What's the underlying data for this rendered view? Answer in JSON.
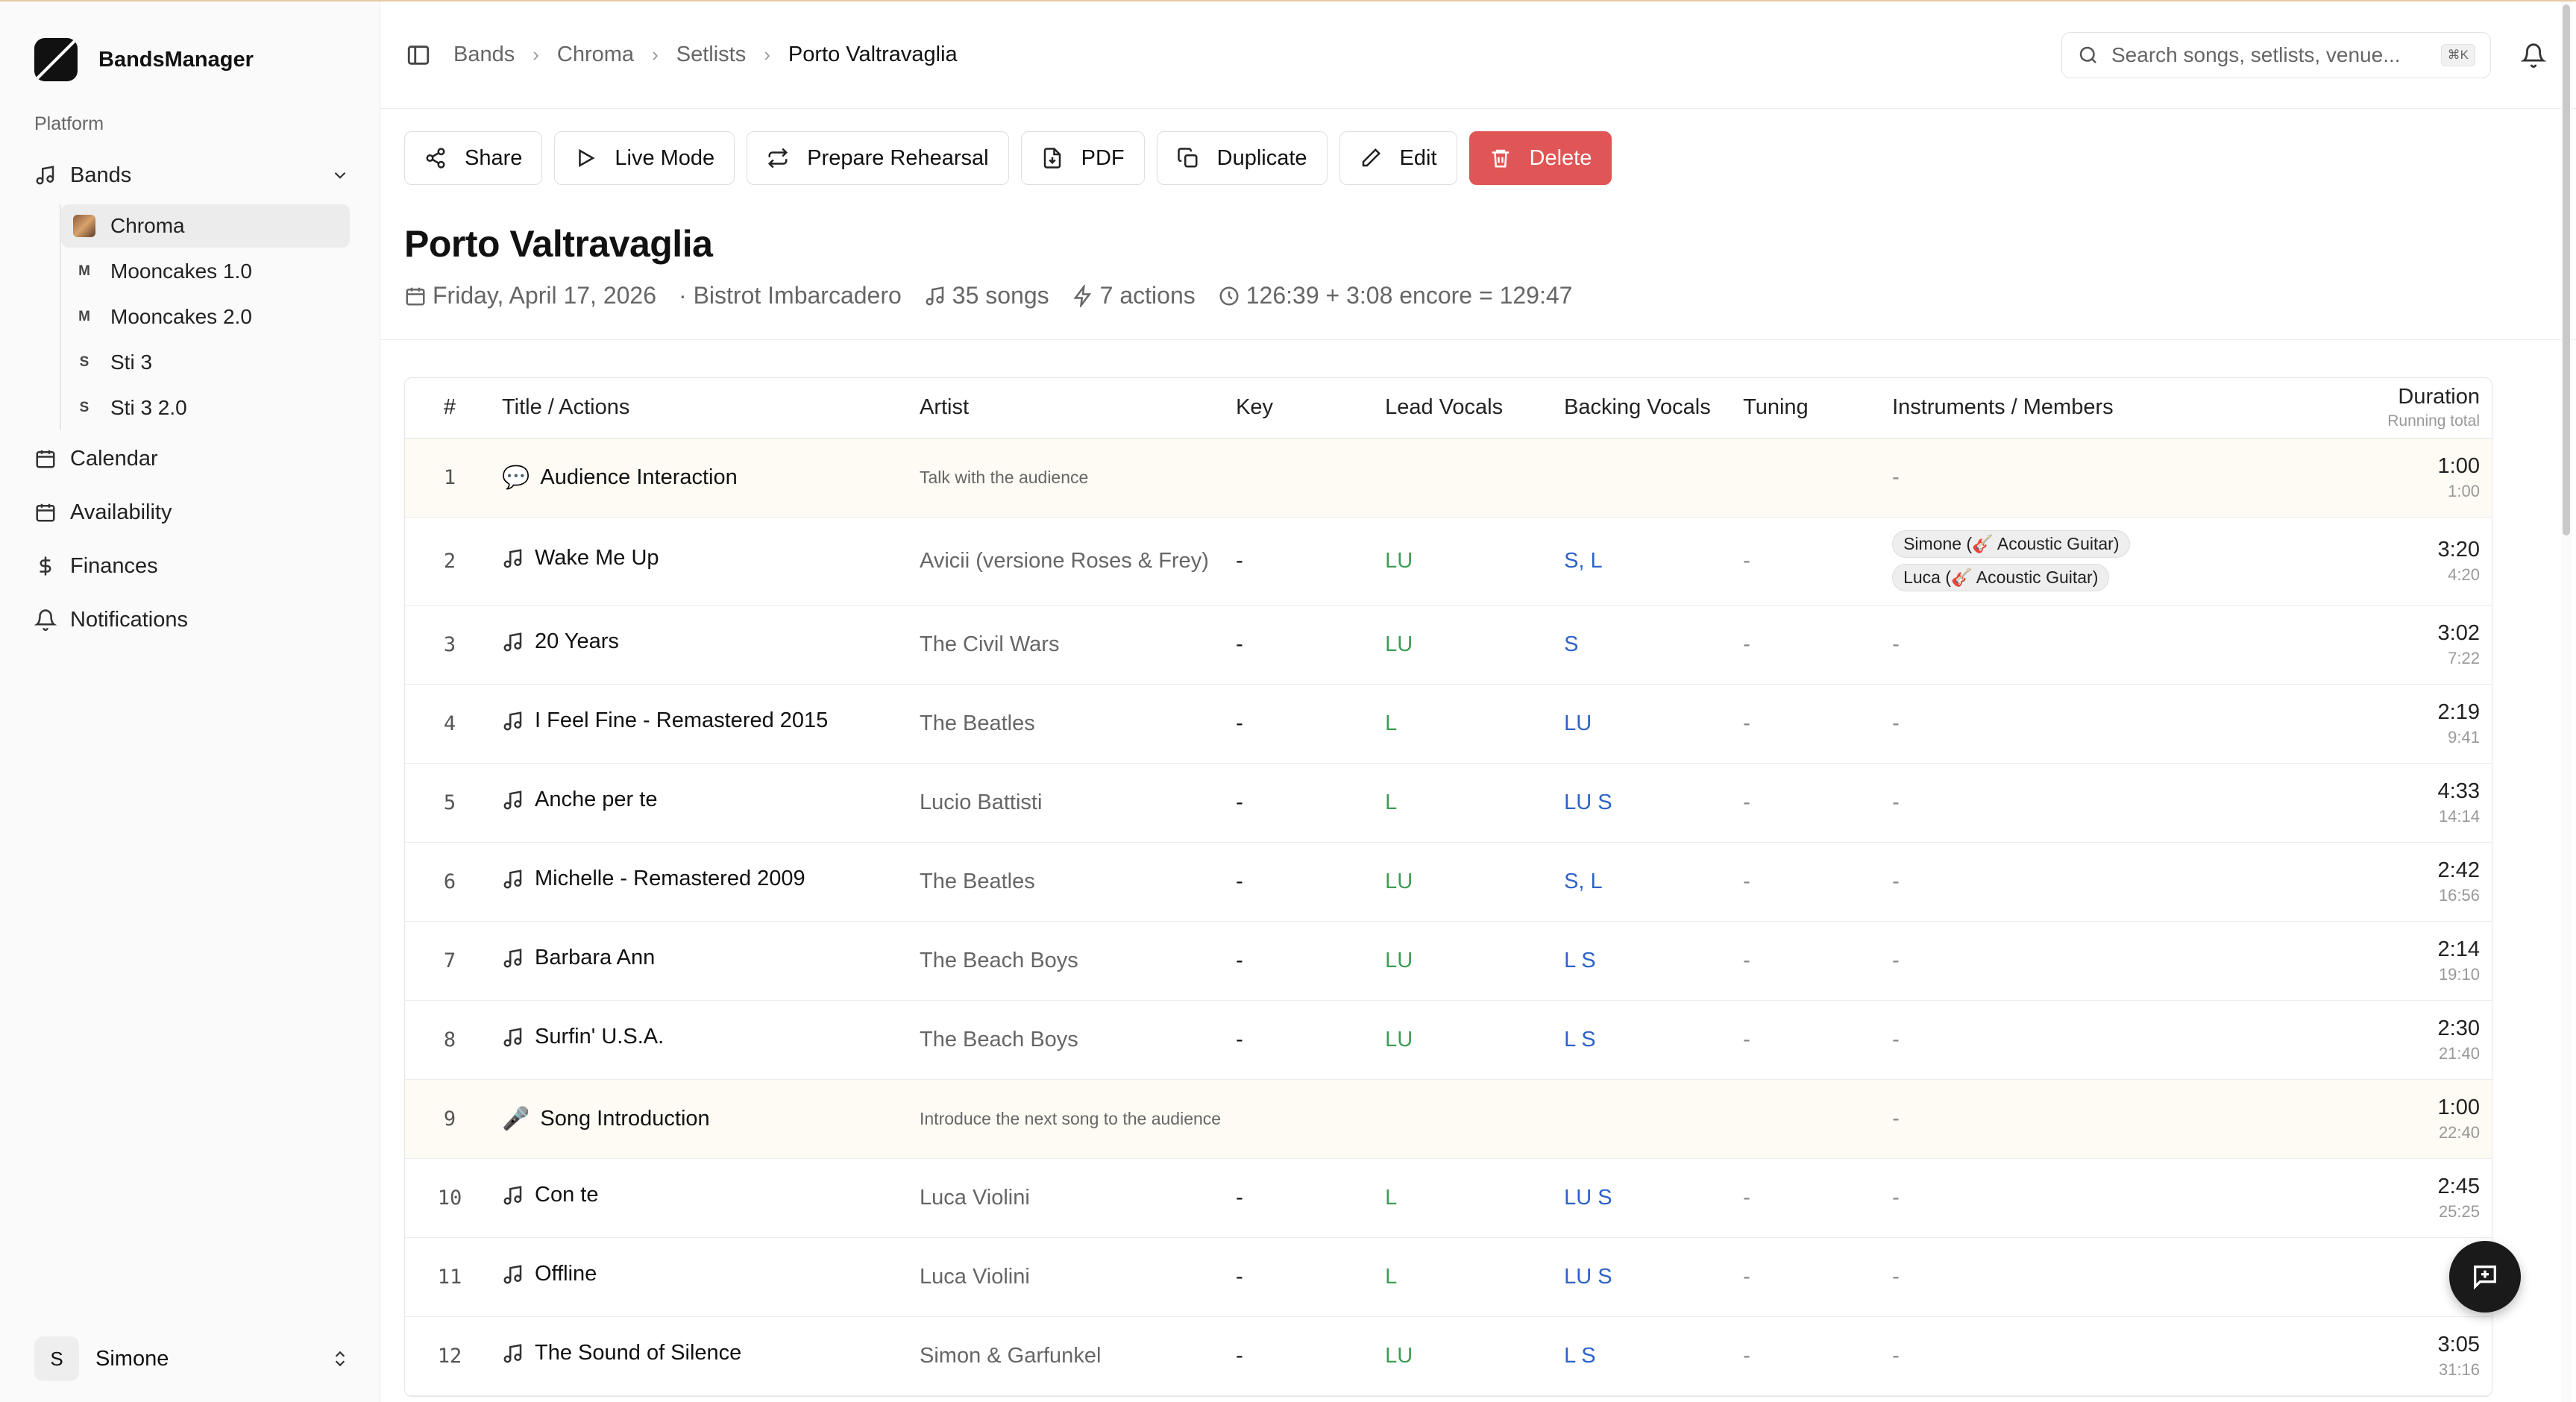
{
  "sidebar": {
    "app_name": "BandsManager",
    "section_label": "Platform",
    "nav": {
      "bands": "Bands",
      "calendar": "Calendar",
      "availability": "Availability",
      "finances": "Finances",
      "notifications": "Notifications"
    },
    "bands": [
      {
        "label": "Chroma",
        "avatar": "",
        "active": true
      },
      {
        "label": "Mooncakes 1.0",
        "avatar": "M"
      },
      {
        "label": "Mooncakes 2.0",
        "avatar": "M"
      },
      {
        "label": "Sti 3",
        "avatar": "S"
      },
      {
        "label": "Sti 3 2.0",
        "avatar": "S"
      }
    ],
    "user": {
      "initial": "S",
      "name": "Simone"
    }
  },
  "header": {
    "breadcrumbs": [
      "Bands",
      "Chroma",
      "Setlists",
      "Porto Valtravaglia"
    ],
    "search_placeholder": "Search songs, setlists, venue...",
    "search_shortcut": "⌘K"
  },
  "toolbar": {
    "share": "Share",
    "live_mode": "Live Mode",
    "prepare_rehearsal": "Prepare Rehearsal",
    "pdf": "PDF",
    "duplicate": "Duplicate",
    "edit": "Edit",
    "delete": "Delete"
  },
  "setlist": {
    "title": "Porto Valtravaglia",
    "date": "Friday, April 17, 2026",
    "venue": "· Bistrot Imbarcadero",
    "songs": "35 songs",
    "actions": "7 actions",
    "duration": "126:39 + 3:08 encore = 129:47"
  },
  "table": {
    "headers": {
      "num": "#",
      "title": "Title / Actions",
      "artist": "Artist",
      "key": "Key",
      "lead": "Lead Vocals",
      "backing": "Backing Vocals",
      "tuning": "Tuning",
      "instruments": "Instruments / Members",
      "duration": "Duration",
      "running": "Running total"
    },
    "rows": [
      {
        "num": "1",
        "type": "action",
        "icon": "speech-bubble-icon",
        "glyph": "💬",
        "title": "Audience Interaction",
        "artist": "Talk with the audience",
        "key": "",
        "lead": "",
        "backing": "",
        "tuning": "",
        "instruments": [
          "-"
        ],
        "duration": "1:00",
        "running": "1:00"
      },
      {
        "num": "2",
        "type": "song",
        "icon": "music-note-icon",
        "title": "Wake Me Up",
        "artist": "Avicii (versione Roses & Frey)",
        "key": "-",
        "lead": "LU",
        "backing": "S, L",
        "tuning": "-",
        "instruments": [
          "Simone (🎸 Acoustic Guitar)",
          "Luca (🎸 Acoustic Guitar)"
        ],
        "duration": "3:20",
        "running": "4:20"
      },
      {
        "num": "3",
        "type": "song",
        "icon": "music-note-icon",
        "title": "20 Years",
        "artist": "The Civil Wars",
        "key": "-",
        "lead": "LU",
        "backing": "S",
        "tuning": "-",
        "instruments": [
          "-"
        ],
        "duration": "3:02",
        "running": "7:22"
      },
      {
        "num": "4",
        "type": "song",
        "icon": "music-note-icon",
        "title": "I Feel Fine - Remastered 2015",
        "artist": "The Beatles",
        "key": "-",
        "lead": "L",
        "backing": "LU",
        "tuning": "-",
        "instruments": [
          "-"
        ],
        "duration": "2:19",
        "running": "9:41"
      },
      {
        "num": "5",
        "type": "song",
        "icon": "music-note-icon",
        "title": "Anche per te",
        "artist": "Lucio Battisti",
        "key": "-",
        "lead": "L",
        "backing": "LU S",
        "tuning": "-",
        "instruments": [
          "-"
        ],
        "duration": "4:33",
        "running": "14:14"
      },
      {
        "num": "6",
        "type": "song",
        "icon": "music-note-icon",
        "title": "Michelle - Remastered 2009",
        "artist": "The Beatles",
        "key": "-",
        "lead": "LU",
        "backing": "S, L",
        "tuning": "-",
        "instruments": [
          "-"
        ],
        "duration": "2:42",
        "running": "16:56"
      },
      {
        "num": "7",
        "type": "song",
        "icon": "music-note-icon",
        "title": "Barbara Ann",
        "artist": "The Beach Boys",
        "key": "-",
        "lead": "LU",
        "backing": "L S",
        "tuning": "-",
        "instruments": [
          "-"
        ],
        "duration": "2:14",
        "running": "19:10"
      },
      {
        "num": "8",
        "type": "song",
        "icon": "music-note-icon",
        "title": "Surfin' U.S.A.",
        "artist": "The Beach Boys",
        "key": "-",
        "lead": "LU",
        "backing": "L S",
        "tuning": "-",
        "instruments": [
          "-"
        ],
        "duration": "2:30",
        "running": "21:40"
      },
      {
        "num": "9",
        "type": "action",
        "icon": "microphone-icon",
        "glyph": "🎤",
        "title": "Song Introduction",
        "artist": "Introduce the next song to the audience",
        "key": "",
        "lead": "",
        "backing": "",
        "tuning": "",
        "instruments": [
          "-"
        ],
        "duration": "1:00",
        "running": "22:40"
      },
      {
        "num": "10",
        "type": "song",
        "icon": "music-note-icon",
        "title": "Con te",
        "artist": "Luca Violini",
        "key": "-",
        "lead": "L",
        "backing": "LU S",
        "tuning": "-",
        "instruments": [
          "-"
        ],
        "duration": "2:45",
        "running": "25:25"
      },
      {
        "num": "11",
        "type": "song",
        "icon": "music-note-icon",
        "title": "Offline",
        "artist": "Luca Violini",
        "key": "-",
        "lead": "L",
        "backing": "LU S",
        "tuning": "-",
        "instruments": [
          "-"
        ],
        "duration": "",
        "running": ""
      },
      {
        "num": "12",
        "type": "song",
        "icon": "music-note-icon",
        "title": "The Sound of Silence",
        "artist": "Simon & Garfunkel",
        "key": "-",
        "lead": "LU",
        "backing": "L S",
        "tuning": "-",
        "instruments": [
          "-"
        ],
        "duration": "3:05",
        "running": "31:16"
      }
    ]
  },
  "colors": {
    "danger": "#e05555",
    "lead": "#3e9d55",
    "backing": "#2e63c8",
    "action_row": "#fdfbf3"
  }
}
